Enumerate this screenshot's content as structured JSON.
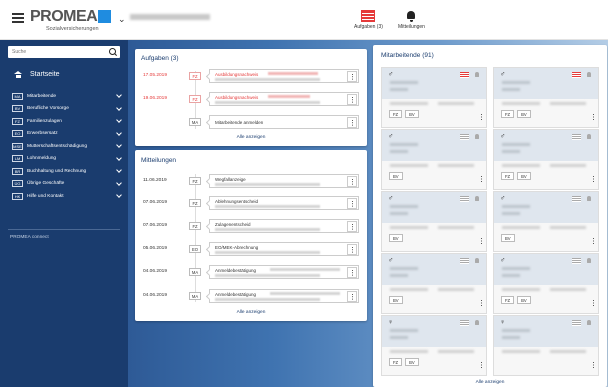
{
  "header": {
    "logo_word": "PROMEA",
    "logo_sub": "Sozialversicherungen",
    "tasks_label": "Aufgaben (3)",
    "notifications_label": "Mitteilungen"
  },
  "sidebar": {
    "search_placeholder": "Suche",
    "home_label": "Startseite",
    "items": [
      {
        "badge": "MA",
        "label": "Mitarbeitende"
      },
      {
        "badge": "BV",
        "label": "Berufliche Vorsorge"
      },
      {
        "badge": "FZ",
        "label": "Familienzulagen"
      },
      {
        "badge": "EO",
        "label": "Erwerbsersatz"
      },
      {
        "badge": "MSE",
        "label": "Mutterschaftsentschädigung"
      },
      {
        "badge": "LM",
        "label": "Lohnmeldung"
      },
      {
        "badge": "BR",
        "label": "Buchhaltung und Rechnung"
      },
      {
        "badge": "ÜG",
        "label": "Übrige Geschäfte"
      },
      {
        "badge": "HK",
        "label": "Hilfe und Kontakt"
      }
    ],
    "connect_label": "PROMEA connect"
  },
  "tasks": {
    "title": "Aufgaben (3)",
    "items": [
      {
        "date": "17.05.2019",
        "badge": "FZ",
        "title": "Ausbildungsnachweis",
        "overdue": true
      },
      {
        "date": "19.06.2019",
        "badge": "FZ",
        "title": "Ausbildungsnachweis",
        "overdue": true
      },
      {
        "date": "",
        "badge": "MA",
        "title": "Mitarbeitende anmelden",
        "overdue": false
      }
    ],
    "show_all": "Alle anzeigen"
  },
  "messages": {
    "title": "Mitteilungen",
    "items": [
      {
        "date": "11.06.2019",
        "badge": "FZ",
        "title": "Wegfallanzeige"
      },
      {
        "date": "07.06.2019",
        "badge": "FZ",
        "title": "Ablehnungsentscheid"
      },
      {
        "date": "07.06.2019",
        "badge": "FZ",
        "title": "Zulagenentscheid"
      },
      {
        "date": "05.06.2019",
        "badge": "EO",
        "title": "EO/MEK-Abrechnung"
      },
      {
        "date": "04.06.2019",
        "badge": "MA",
        "title": "Anmeldebestätigung"
      },
      {
        "date": "04.06.2019",
        "badge": "MA",
        "title": "Anmeldebestätigung"
      }
    ],
    "show_all": "Alle anzeigen"
  },
  "employees": {
    "title": "Mitarbeitende (91)",
    "cards": [
      {
        "gender": "♂",
        "flag": "red",
        "badges": [
          "FZ",
          "BV"
        ]
      },
      {
        "gender": "♂",
        "flag": "red",
        "badges": [
          "FZ",
          "BV"
        ]
      },
      {
        "gender": "♂",
        "flag": "grey",
        "badges": [
          "BV"
        ]
      },
      {
        "gender": "♂",
        "flag": "grey",
        "badges": [
          "FZ",
          "BV"
        ]
      },
      {
        "gender": "♂",
        "flag": "grey",
        "badges": [
          "BV"
        ]
      },
      {
        "gender": "♂",
        "flag": "grey",
        "badges": [
          "BV"
        ]
      },
      {
        "gender": "♂",
        "flag": "grey",
        "badges": [
          "BV"
        ]
      },
      {
        "gender": "♂",
        "flag": "grey",
        "badges": [
          "FZ",
          "BV"
        ]
      },
      {
        "gender": "♀",
        "flag": "grey",
        "badges": [
          "FZ",
          "BV"
        ]
      },
      {
        "gender": "♀",
        "flag": "grey",
        "badges": []
      }
    ],
    "show_all": "Alle anzeigen"
  },
  "colors": {
    "navy": "#1a3c6e",
    "accent_blue": "#1f8ce0",
    "alert_red": "#e53a3a"
  }
}
